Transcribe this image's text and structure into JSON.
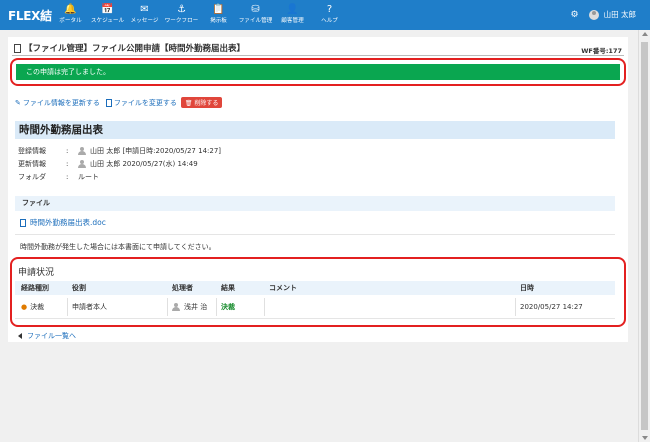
{
  "app": {
    "logo": "FLEX結"
  },
  "nav": [
    {
      "icon": "bell-icon",
      "glyph": "🔔",
      "label": "ポータル"
    },
    {
      "icon": "calendar-icon",
      "glyph": "📅",
      "label": "スケジュール"
    },
    {
      "icon": "mail-icon",
      "glyph": "✉",
      "label": "メッセージ"
    },
    {
      "icon": "workflow-icon",
      "glyph": "⚓",
      "label": "ワークフロー"
    },
    {
      "icon": "board-icon",
      "glyph": "📋",
      "label": "掲示板"
    },
    {
      "icon": "folder-icon",
      "glyph": "⛁",
      "label": "ファイル管理"
    },
    {
      "icon": "person-icon",
      "glyph": "👤",
      "label": "顧客管理"
    },
    {
      "icon": "help-icon",
      "glyph": "?",
      "label": "ヘルプ"
    }
  ],
  "user": {
    "name": "山田 太郎"
  },
  "page": {
    "title": "【ファイル管理】ファイル公開申請【時間外勤務届出表】",
    "wf_number": "WF番号:177",
    "alert": "この申請は完了しました。"
  },
  "actions": {
    "update_info": "ファイル情報を更新する",
    "change_file": "ファイルを変更する",
    "delete": "削除する"
  },
  "document": {
    "title": "時間外勤務届出表",
    "registered_label": "登録情報",
    "registered_value": "山田 太郎 [申請日時:2020/05/27 14:27]",
    "updated_label": "更新情報",
    "updated_value": "山田 太郎 2020/05/27(水) 14:49",
    "folder_label": "フォルダ",
    "folder_value": "ルート",
    "colon": ":"
  },
  "file": {
    "section_label": "ファイル",
    "file_name": "時間外勤務届出表.doc",
    "note": "時間外勤務が発生した場合には本書面にて申請してください。"
  },
  "status": {
    "title": "申請状況",
    "columns": [
      "経路種別",
      "役割",
      "処理者",
      "結果",
      "コメント",
      "日時"
    ],
    "rows": [
      {
        "route": "決裁",
        "role": "申請者本人",
        "processor": "浅井 治",
        "result": "決裁",
        "comment": "",
        "datetime": "2020/05/27 14:27"
      }
    ]
  },
  "back_link": "ファイル一覧へ",
  "colors": {
    "nav_bg": "#1f7ec9",
    "alert_green": "#0aa650",
    "highlight_red": "#e32020",
    "link_blue": "#1b6dbb"
  }
}
